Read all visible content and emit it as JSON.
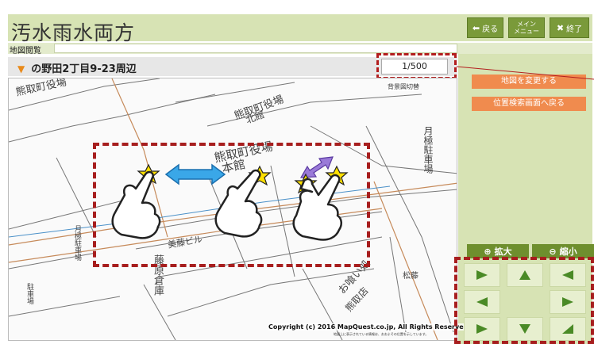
{
  "app": {
    "title": "汚水雨水両方",
    "back_label": "戻る",
    "menu_label": "メイン\nメニュー",
    "exit_label": "終了"
  },
  "subheader": {
    "label": "地図閲覧"
  },
  "location": {
    "title": "の野田2丁目9-23周辺"
  },
  "scale": {
    "value": "1/500"
  },
  "map": {
    "bg_toggle": "背景図切替",
    "copyright": "Copyright (c) 2016 MapQuest.co.jp, All Rights Reserved.",
    "copyright_note": "地図上に表示されている情報は、おおよその位置を示しています。",
    "labels": [
      "熊取町役場",
      "北館",
      "熊取町役場",
      "本館",
      "月極駐車場",
      "藤原倉庫",
      "お喰い処",
      "熊取店",
      "松藤",
      "美藤ビル",
      "駐車場",
      "月極駐車場"
    ]
  },
  "side": {
    "change_map": "地図を変更する",
    "back_to_search": "位置検索画面へ戻る",
    "zoom_in": "拡大",
    "zoom_out": "縮小"
  },
  "colors": {
    "accent": "#7a9a3a",
    "panel": "#d7e3b4",
    "orange": "#f08b4e",
    "dash": "#a71e1e"
  }
}
